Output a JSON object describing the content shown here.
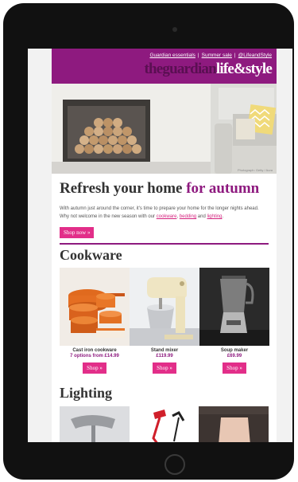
{
  "header": {
    "links": [
      "Guardian essentials",
      "Summer sale",
      "@LifeandStyle"
    ],
    "separator": "|",
    "brand": "theguardian",
    "section": "life&style"
  },
  "hero": {
    "credit": "Photograph: Getty / Aura"
  },
  "main": {
    "headline_start": "Refresh your home",
    "headline_accent": "for autumn",
    "intro_text": "With autumn just around the corner, it's time to prepare your home for the longer nights ahead. Why not welcome in the new season with our",
    "intro_links": [
      "cookware",
      "bedding",
      "lighting"
    ],
    "intro_and": "and",
    "intro_comma": ",",
    "intro_end": ".",
    "shop_now_label": "Shop now »"
  },
  "cookware": {
    "title": "Cookware",
    "products": [
      {
        "name": "Cast iron cookware",
        "price": "7 options from £14.99",
        "button": "Shop »"
      },
      {
        "name": "Stand mixer",
        "price": "£119.99",
        "button": "Shop »"
      },
      {
        "name": "Soup maker",
        "price": "£69.99",
        "button": "Shop »"
      }
    ]
  },
  "lighting": {
    "title": "Lighting"
  },
  "colors": {
    "brand_purple": "#8e1a7f",
    "button_pink": "#e22e89"
  }
}
